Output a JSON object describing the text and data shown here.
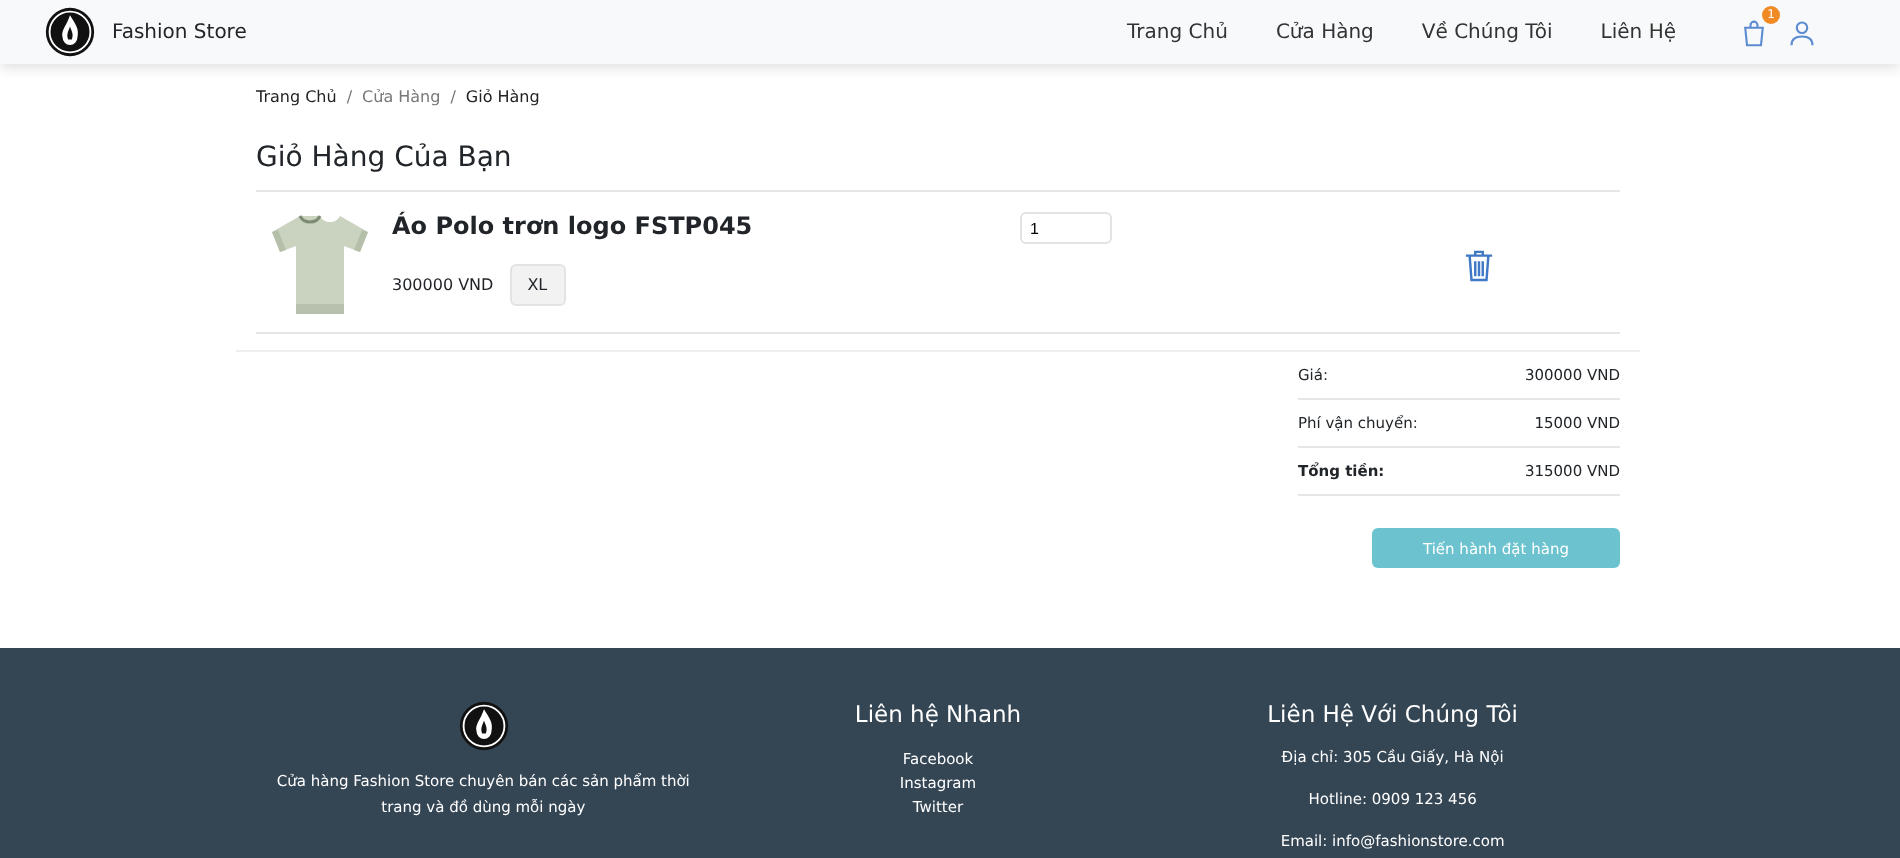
{
  "navbar": {
    "brand": "Fashion Store",
    "links": [
      {
        "label": "Trang Chủ",
        "selected": false
      },
      {
        "label": "Cửa Hàng",
        "selected": false
      },
      {
        "label": "Về Chúng Tôi",
        "selected": false
      },
      {
        "label": "Liên Hệ",
        "selected": false
      }
    ],
    "cart_count": "1"
  },
  "breadcrumb": [
    {
      "label": "Trang Chủ",
      "kind": "link"
    },
    {
      "label": "/",
      "kind": "separator"
    },
    {
      "label": "Cửa Hàng",
      "kind": "muted"
    },
    {
      "label": "/",
      "kind": "separator"
    },
    {
      "label": "Giỏ Hàng",
      "kind": "current"
    }
  ],
  "title": "Giỏ Hàng Của Bạn",
  "cart_items": [
    {
      "name": "Áo Polo trơn logo FSTP045",
      "price": "300000 VND",
      "size": "XL",
      "quantity": "1"
    }
  ],
  "summary": [
    {
      "label": "Giá:",
      "value": "300000 VND",
      "kind": "normal"
    },
    {
      "label": "Phí vận chuyển:",
      "value": "15000 VND",
      "kind": "normal"
    },
    {
      "label": "Tổng tiền:",
      "value": "315000 VND",
      "kind": "total"
    }
  ],
  "checkout_button": "Tiến hành đặt hàng",
  "footer": {
    "about": "Cửa hàng Fashion Store chuyên bán các sản phẩm thời trang và đồ dùng mỗi ngày",
    "quick_title": "Liên hệ Nhanh",
    "quick_links": [
      "Facebook",
      "Instagram",
      "Twitter"
    ],
    "contact_title": "Liên Hệ Với Chúng Tôi",
    "contact_lines": [
      "Địa chỉ: 305 Cầu Giấy, Hà Nội",
      "Hotline: 0909 123 456",
      "Email: info@fashionstore.com"
    ]
  }
}
